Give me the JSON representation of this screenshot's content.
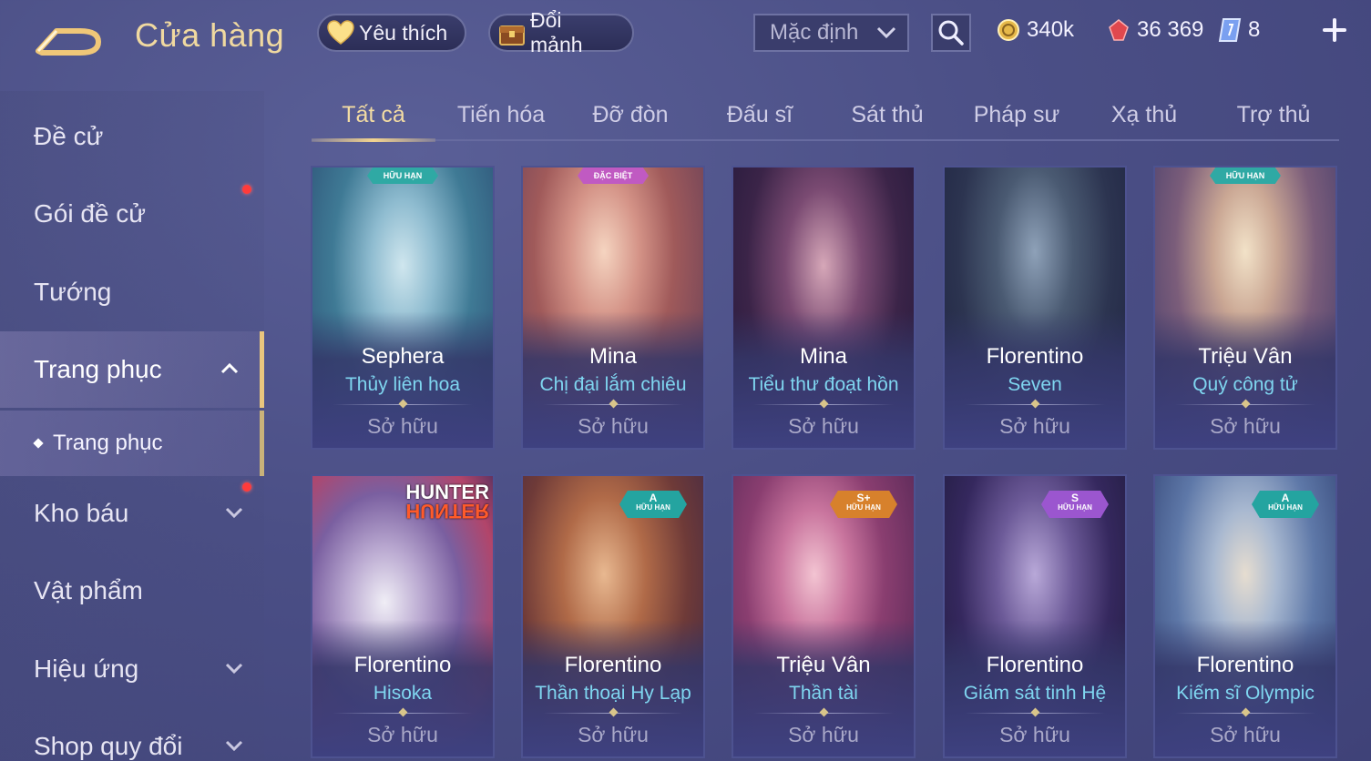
{
  "header": {
    "title": "Cửa hàng",
    "favorite_label": "Yêu thích",
    "shard_label": "Đổi mảnh",
    "sort": {
      "selected": "Mặc định"
    },
    "currency": {
      "gold": "340k",
      "gems": "36 369",
      "tickets": "8"
    }
  },
  "sidebar": {
    "items": [
      {
        "label": "Đề cử"
      },
      {
        "label": "Gói đề cử"
      },
      {
        "label": "Tướng"
      },
      {
        "label": "Trang phục"
      },
      {
        "label": "Kho báu"
      },
      {
        "label": "Vật phẩm"
      },
      {
        "label": "Hiệu ứng"
      },
      {
        "label": "Shop quy đổi"
      }
    ],
    "sub_item": "Trang phục"
  },
  "tabs": [
    {
      "label": "Tất cả"
    },
    {
      "label": "Tiến hóa"
    },
    {
      "label": "Đỡ đòn"
    },
    {
      "label": "Đấu sĩ"
    },
    {
      "label": "Sát thủ"
    },
    {
      "label": "Pháp sư"
    },
    {
      "label": "Xạ thủ"
    },
    {
      "label": "Trợ thủ"
    }
  ],
  "cards": [
    {
      "hero": "Sephera",
      "skin": "Thủy liên hoa",
      "status": "Sở hữu",
      "tag": "HỮU HẠN"
    },
    {
      "hero": "Mina",
      "skin": "Chị đại lắm chiêu",
      "status": "Sở hữu",
      "tag": "ĐẶC BIỆT"
    },
    {
      "hero": "Mina",
      "skin": "Tiểu thư đoạt hồn",
      "status": "Sở hữu"
    },
    {
      "hero": "Florentino",
      "skin": "Seven",
      "status": "Sở hữu"
    },
    {
      "hero": "Triệu Vân",
      "skin": "Quý công tử",
      "status": "Sở hữu",
      "tag": "HỮU HẠN"
    },
    {
      "hero": "Florentino",
      "skin": "Hisoka",
      "status": "Sở hữu",
      "logo_top": "HUNTER",
      "logo_bottom": "HUNTER"
    },
    {
      "hero": "Florentino",
      "skin": "Thần thoại Hy Lạp",
      "status": "Sở hữu",
      "rank": "A",
      "rank_sub": "HỮU HẠN"
    },
    {
      "hero": "Triệu Vân",
      "skin": "Thần tài",
      "status": "Sở hữu",
      "rank": "S+",
      "rank_sub": "HỮU HẠN"
    },
    {
      "hero": "Florentino",
      "skin": "Giám sát tinh Hệ",
      "status": "Sở hữu",
      "rank": "S",
      "rank_sub": "HỮU HẠN"
    },
    {
      "hero": "Florentino",
      "skin": "Kiếm sĩ Olympic",
      "status": "Sở hữu",
      "rank": "A",
      "rank_sub": "HỮU HẠN"
    }
  ],
  "colors": {
    "accent_gold": "#f0d9a0",
    "skin_name": "#7fd6f0",
    "notify_dot": "#ff3b3b"
  }
}
